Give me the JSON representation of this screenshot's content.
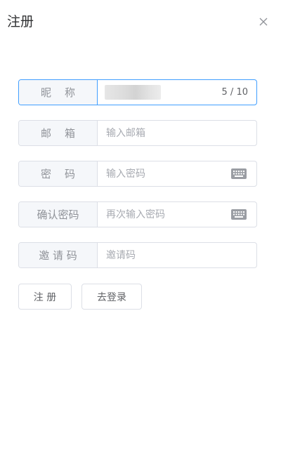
{
  "dialog": {
    "title": "注册",
    "close_icon": "close-icon"
  },
  "form": {
    "nickname": {
      "label": "昵    称",
      "value": "",
      "counter": "5 / 10"
    },
    "email": {
      "label": "邮    箱",
      "placeholder": "输入邮箱",
      "value": ""
    },
    "password": {
      "label": "密    码",
      "placeholder": "输入密码",
      "value": "",
      "icon": "keyboard-icon"
    },
    "confirm_password": {
      "label": "确认密码",
      "placeholder": "再次输入密码",
      "value": "",
      "icon": "keyboard-icon"
    },
    "invite_code": {
      "label": "邀 请 码",
      "placeholder": "邀请码",
      "value": ""
    }
  },
  "actions": {
    "register_label": "注 册",
    "login_label": "去登录"
  },
  "colors": {
    "border": "#dcdfe6",
    "focus_border": "#409eff",
    "label_bg": "#f5f7fa",
    "label_text": "#909399",
    "placeholder": "#a8abb2"
  }
}
